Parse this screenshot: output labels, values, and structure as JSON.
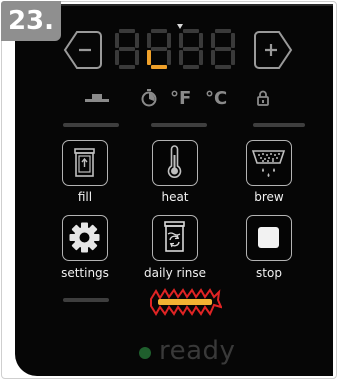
{
  "step": {
    "number": "23."
  },
  "display": {
    "digits": [
      "8",
      "8",
      "8",
      "8"
    ],
    "active_segment_color": "#f0a12a",
    "inactive_segment_color": "#3a3a3a"
  },
  "controls": {
    "minus_icon": "minus-icon",
    "plus_icon": "plus-icon"
  },
  "indicators": {
    "units_f": "°F",
    "units_c": "°C",
    "timer_icon": "timer-icon",
    "lock_icon": "lock-icon",
    "lid_icon": "lid-icon"
  },
  "buttons": [
    {
      "key": "fill",
      "label": "fill",
      "icon": "fill-icon"
    },
    {
      "key": "heat",
      "label": "heat",
      "icon": "thermometer-icon"
    },
    {
      "key": "brew",
      "label": "brew",
      "icon": "brew-basket-icon"
    },
    {
      "key": "settings",
      "label": "settings",
      "icon": "gear-icon"
    },
    {
      "key": "daily_rinse",
      "label": "daily rinse",
      "icon": "rinse-icon"
    },
    {
      "key": "stop",
      "label": "stop",
      "icon": "stop-icon"
    }
  ],
  "highlight": {
    "color": "#f2b233",
    "accent": "#e02424"
  },
  "status": {
    "text": "ready",
    "dot_color": "#1f5f2d"
  }
}
